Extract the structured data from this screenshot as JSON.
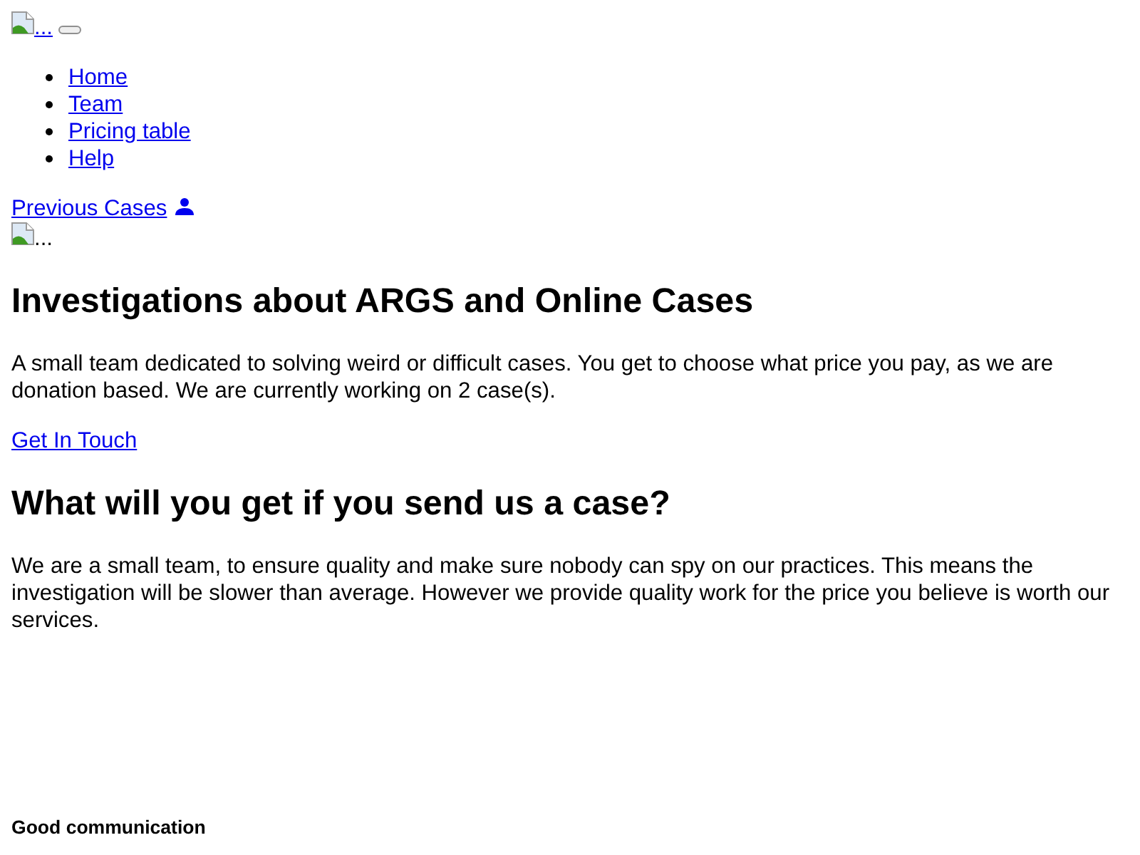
{
  "navbar": {
    "brand": {
      "alt_text": "..."
    },
    "links": [
      {
        "label": "Home"
      },
      {
        "label": "Team"
      },
      {
        "label": "Pricing table"
      },
      {
        "label": "Help"
      }
    ],
    "account_link": {
      "label": "Previous Cases"
    }
  },
  "hero": {
    "image_alt_text": "...",
    "title": "Investigations about ARGS and Online Cases",
    "text": "A small team dedicated to solving weird or difficult cases. You get to choose what price you pay, as we are donation based. We are currently working on 2 case(s).",
    "button": "Get In Touch"
  },
  "about": {
    "title": "What will you get if you send us a case?",
    "text": "We are a small team, to ensure quality and make sure nobody can spy on our practices. This means the investigation will be slower than average. However we provide quality work for the price you believe is worth our services."
  },
  "features": [
    {
      "title": "Good communication"
    }
  ]
}
